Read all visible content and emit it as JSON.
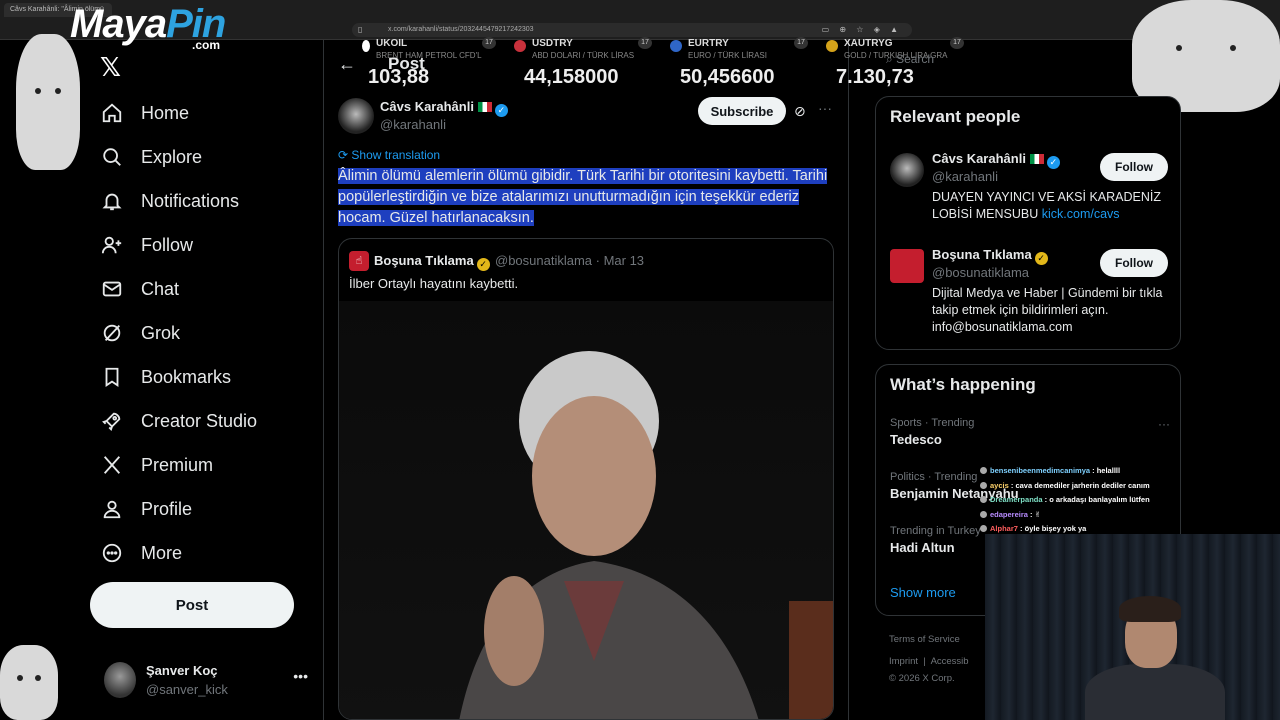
{
  "browser": {
    "tab_title": "Câvs Karahânli: \"Âlimin ölümü",
    "url": "x.com/karahanli/status/2032445479217242303"
  },
  "overlay": {
    "logo_main": "Maya",
    "logo_accent": "Pin",
    "logo_suffix": ".com"
  },
  "ticker": [
    {
      "symbol": "UKOIL",
      "desc": "BRENT HAM PETROL CFD'L",
      "value": "103,88",
      "color": "#ffffff"
    },
    {
      "symbol": "USDTRY",
      "desc": "ABD DOLARI / TÜRK LİRAS",
      "value": "44,158000",
      "color": "#c8313c"
    },
    {
      "symbol": "EURTRY",
      "desc": "EURO / TÜRK LİRASI",
      "value": "50,456600",
      "color": "#2f66c8"
    },
    {
      "symbol": "XAUTRYG",
      "desc": "GOLD / TURKISH LIRA GRA",
      "value": "7.130,73",
      "color": "#d4a21a"
    }
  ],
  "nav": {
    "items": [
      {
        "label": "Home",
        "icon": "home-icon"
      },
      {
        "label": "Explore",
        "icon": "search-icon"
      },
      {
        "label": "Notifications",
        "icon": "bell-icon"
      },
      {
        "label": "Follow",
        "icon": "follow-icon"
      },
      {
        "label": "Chat",
        "icon": "mail-icon"
      },
      {
        "label": "Grok",
        "icon": "grok-icon"
      },
      {
        "label": "Bookmarks",
        "icon": "bookmark-icon"
      },
      {
        "label": "Creator Studio",
        "icon": "rocket-icon"
      },
      {
        "label": "Premium",
        "icon": "x-icon"
      },
      {
        "label": "Profile",
        "icon": "person-icon"
      },
      {
        "label": "More",
        "icon": "more-icon"
      }
    ],
    "post_button": "Post"
  },
  "account": {
    "name": "Şanver Koç",
    "handle": "@sanver_kick"
  },
  "post": {
    "header": "Post",
    "author_name": "Câvs Karahânli",
    "author_handle": "@karahanli",
    "subscribe": "Subscribe",
    "show_translation": "Show translation",
    "text": "Âlimin ölümü alemlerin ölümü gibidir. Türk Tarihi bir otoritesini kaybetti. Tarihi popülerleştirdiğin ve bize atalarımızı unutturmadığın için teşekkür ederiz hocam. Güzel hatırlanacaksın.",
    "quote": {
      "author_name": "Boşuna Tıklama",
      "meta": "@bosunatiklama · Mar 13",
      "text": "İlber Ortaylı hayatını kaybetti."
    }
  },
  "sidebar": {
    "search_placeholder": "Search",
    "relevant_title": "Relevant people",
    "people": [
      {
        "name": "Câvs Karahânli",
        "handle": "@karahanli",
        "bio": "DUAYEN YAYINCI VE AKSİ KARADENİZ LOBİSİ MENSUBU ",
        "link": "kick.com/cavs",
        "follow": "Follow"
      },
      {
        "name": "Boşuna Tıklama",
        "handle": "@bosunatiklama",
        "bio": "Dijital Medya ve Haber | Gündemi bir tıkla takip etmek için bildirimleri açın. info@bosunatiklama.com",
        "link": "",
        "follow": "Follow"
      }
    ],
    "happening_title": "What’s happening",
    "trends": [
      {
        "category": "Sports · Trending",
        "name": "Tedesco"
      },
      {
        "category": "Politics · Trending",
        "name": "Benjamin Netanyahu"
      },
      {
        "category": "Trending in Turkey",
        "name": "Hadi Altun"
      }
    ],
    "show_more": "Show more",
    "footer": [
      "Terms of Service",
      "Imprint",
      "Accessib",
      "© 2026 X Corp."
    ]
  },
  "chat": [
    {
      "user": "bensenibeenmedimcanimya",
      "msg": ": helallll",
      "color": "#7fd1ff"
    },
    {
      "user": "aycis",
      "msg": ": cava demediler jarherin dediler canım",
      "color": "#ffd36b"
    },
    {
      "user": "Dreamerpanda",
      "msg": ": o arkadaşı banlayalım lütfen",
      "color": "#7fe0c6"
    },
    {
      "user": "edapereira",
      "msg": ": ✌",
      "color": "#b88cff"
    },
    {
      "user": "Alphar7",
      "msg": ": öyle bişey yok ya",
      "color": "#ff5e5e"
    }
  ]
}
